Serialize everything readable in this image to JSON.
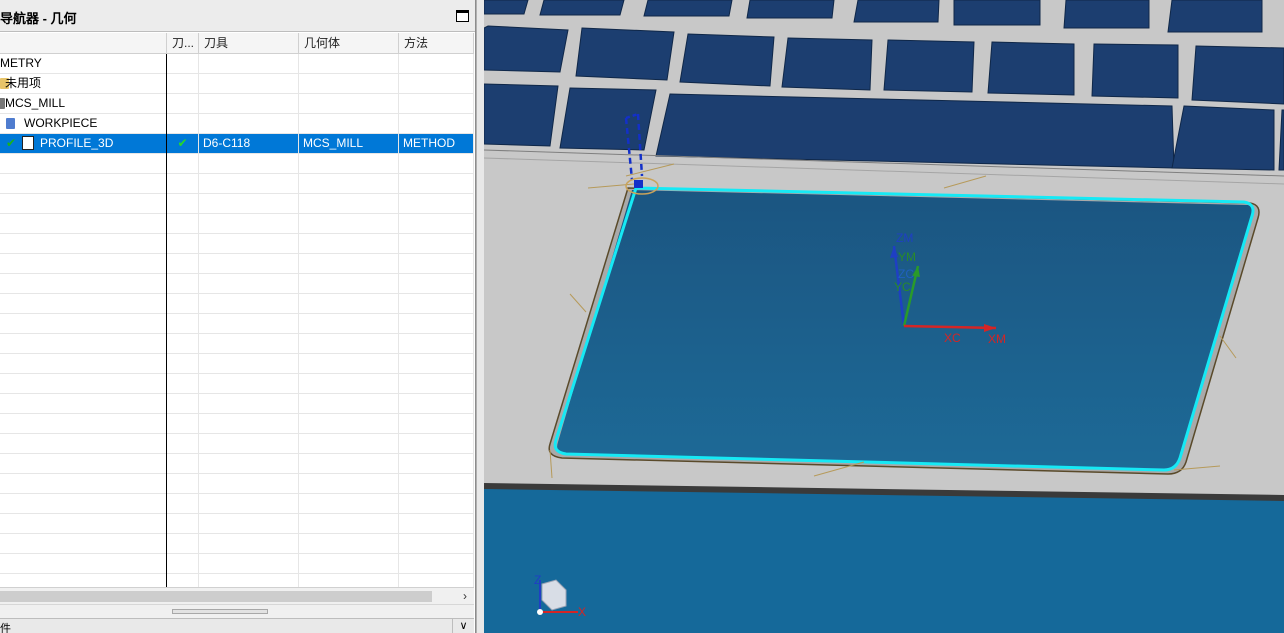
{
  "navigator": {
    "title": "导航器 - 几何",
    "columns": [
      "",
      "刀...",
      "刀具",
      "几何体",
      "方法"
    ],
    "rows": [
      {
        "name": "METRY",
        "status": "",
        "tool": "",
        "geometry": "",
        "method": ""
      },
      {
        "name": "未用项",
        "status": "",
        "tool": "",
        "geometry": "",
        "method": ""
      },
      {
        "name": "MCS_MILL",
        "status": "",
        "tool": "",
        "geometry": "",
        "method": ""
      },
      {
        "name": "WORKPIECE",
        "status": "",
        "tool": "",
        "geometry": "",
        "method": ""
      },
      {
        "name": "PROFILE_3D",
        "status": "✔",
        "tool": "D6-C118",
        "geometry": "MCS_MILL",
        "method": "METHOD"
      }
    ],
    "detail_label": "件"
  },
  "viewport": {
    "wcs_labels": {
      "zm": "ZM",
      "ym": "YM",
      "zc": "ZC",
      "yc": "YC",
      "xc": "XC",
      "xm": "XM"
    },
    "triad_labels": {
      "z": "Z",
      "x": "X"
    },
    "colors": {
      "highlight": "#16e9f5",
      "face": "#1a5a85",
      "bottom_face": "#15699a",
      "panel": "#c9c9c9",
      "keycap": "#1c3e70"
    }
  }
}
